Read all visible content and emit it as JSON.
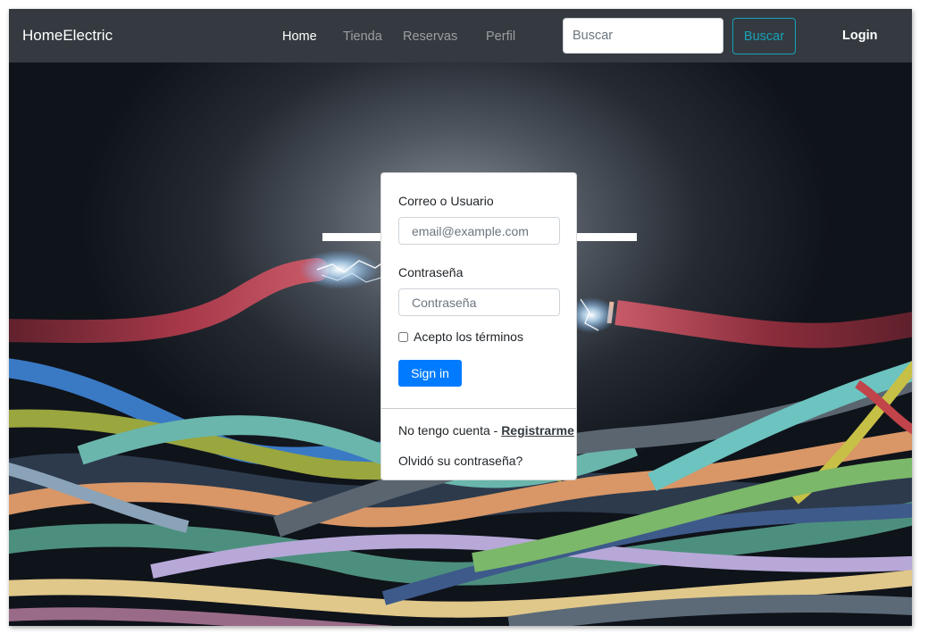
{
  "navbar": {
    "brand": "HomeElectric",
    "links": [
      {
        "label": "Home",
        "active": true
      },
      {
        "label": "Tienda",
        "active": false
      },
      {
        "label": "Reservas",
        "active": false
      },
      {
        "label": "Perfil",
        "active": false
      }
    ],
    "search_placeholder": "Buscar",
    "search_button": "Buscar",
    "login": "Login"
  },
  "login_form": {
    "user_label": "Correo o Usuario",
    "user_placeholder": "email@example.com",
    "password_label": "Contraseña",
    "password_placeholder": "Contraseña",
    "terms_label": "Acepto los términos",
    "terms_checked": false,
    "signin_button": "Sign in",
    "no_account_text": "No tengo cuenta - ",
    "register_link": "Registrarme",
    "forgot_password": "Olvidó su contraseña?"
  },
  "colors": {
    "navbar_bg": "#343a40",
    "search_button_accent": "#17a2b8",
    "signin_button": "#007bff"
  }
}
